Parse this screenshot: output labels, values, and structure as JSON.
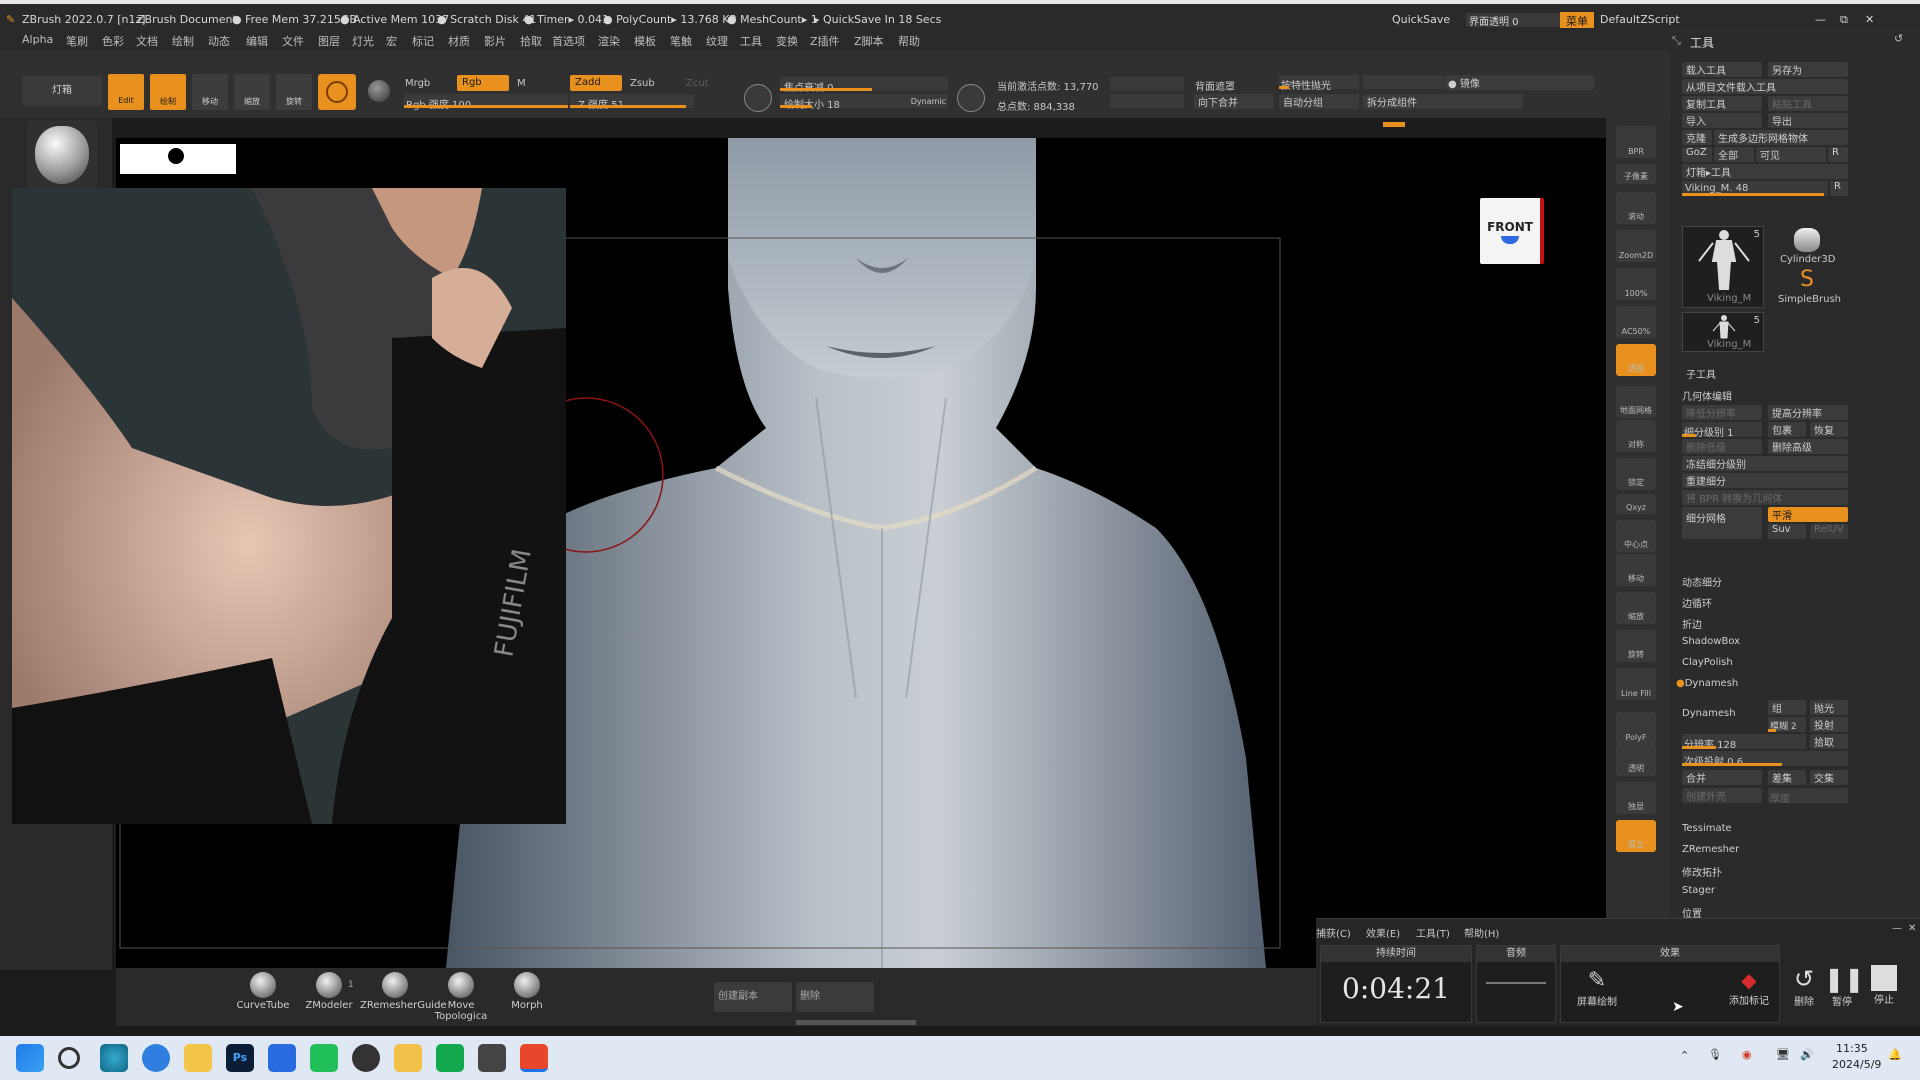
{
  "titlebar": {
    "app": "ZBrush 2022.0.7 [n1z]",
    "doc": "ZBrush Document",
    "free_mem": "● Free Mem 37.215GB",
    "active_mem": "● Active Mem 1037",
    "scratch": "● Scratch Disk 41",
    "timer": "● Timer▸ 0.041",
    "poly": "● PolyCount▸ 13.768 KP",
    "mesh": "● MeshCount▸ 1",
    "quicksave": "▸ QuickSave In 18 Secs",
    "quicksave_btn": "QuickSave",
    "interface_trans": "界面透明 0",
    "menu_btn": "菜单",
    "script": "DefaultZScript"
  },
  "menus": [
    "Alpha",
    "笔刷",
    "色彩",
    "文档",
    "绘制",
    "动态",
    "编辑",
    "文件",
    "图层",
    "灯光",
    "宏",
    "标记",
    "材质",
    "影片",
    "拾取",
    "首选项",
    "渲染",
    "模板",
    "笔触",
    "纹理",
    "工具",
    "变换",
    "Z插件",
    "Z脚本",
    "帮助"
  ],
  "shelf": {
    "lightbox": "灯箱",
    "edit": "Edit",
    "draw": "绘制",
    "move": "移动",
    "scale": "缩放",
    "rotate": "旋转",
    "mrgb": "Mrgb",
    "rgb": "Rgb",
    "m": "M",
    "rgb_intensity": "Rgb 强度 100",
    "zadd": "Zadd",
    "zsub": "Zsub",
    "zcut": "Zcut",
    "focal_shift": "焦点衰减 0",
    "draw_size": "绘制大小 18",
    "dynamic": "Dynamic",
    "active_points": "当前激活点数: 13,770",
    "total_points": "总点数: 884,338",
    "z_intensity": "Z 强度 51",
    "backface": "背面遮罩",
    "merge_down": "向下合并",
    "auto_group": "自动分组",
    "polish": "按特性抛光",
    "split_group": "拆分成组件",
    "mirror": "镜像"
  },
  "reference_image": {
    "brand": "FUJIFILM"
  },
  "nav": [
    {
      "label": "BPR"
    },
    {
      "label": "子像素"
    },
    {
      "label": "滚动"
    },
    {
      "label": "Zoom2D"
    },
    {
      "label": "100%"
    },
    {
      "label": "AC50%"
    },
    {
      "label": "透视"
    },
    {
      "label": "地面网格"
    },
    {
      "label": "对称"
    },
    {
      "label": "锁定"
    },
    {
      "label": "Qxyz"
    },
    {
      "label": "中心点"
    },
    {
      "label": "移动"
    },
    {
      "label": "缩放"
    },
    {
      "label": "旋转"
    },
    {
      "label": "Line Fill"
    },
    {
      "label": "PolyF"
    },
    {
      "label": "透明"
    },
    {
      "label": "独显"
    },
    {
      "label": "孤立"
    }
  ],
  "gizmo": {
    "label": "FRONT"
  },
  "tool_panel": {
    "title": "工具",
    "load": "载入工具",
    "save_as": "另存为",
    "load_from_project": "从项目文件载入工具",
    "copy": "复制工具",
    "paste": "粘贴工具",
    "import": "导入",
    "export": "导出",
    "clone": "克隆",
    "make_polymesh": "生成多边形网格物体",
    "goz": "GoZ",
    "all": "全部",
    "visible": "可见",
    "r": "R",
    "lightbox_tools": "灯箱▸工具",
    "viking_slider": "Viking_M. 48",
    "thumb1": "Viking_M",
    "thumb1_n": "5",
    "thumb2": "Cylinder3D",
    "thumb3": "SimpleBrush",
    "thumb4": "Viking_M",
    "thumb4_n": "5",
    "subtool": "子工具",
    "geometry": "几何体编辑",
    "lower_res": "降低分辨率",
    "higher_res": "提高分辨率",
    "sdiv": "细分级别 1",
    "cage": "包裹",
    "restore": "恢复",
    "del_lower": "删除低级",
    "del_higher": "删除高级",
    "freeze": "冻结细分级别",
    "reconstruct": "重建细分",
    "convert_bpr": "将 BPR 转换为几何体",
    "divide": "细分网格",
    "smooth": "平滑",
    "suv": "Suv",
    "reluv": "RelUV",
    "dyn_subdiv": "动态细分",
    "edge_loop": "边循环",
    "crease": "折边",
    "shadowbox": "ShadowBox",
    "claypolish": "ClayPolish",
    "dynamesh_h": "Dynamesh",
    "dynamesh": "Dynamesh",
    "group": "组",
    "polish": "抛光",
    "blur": "模糊 2",
    "project": "投射",
    "resolution": "分辨率 128",
    "sub_proj": "次级投射 0.6",
    "add": "合并",
    "sub": "差集",
    "intersect": "交集",
    "create_shell": "创建外壳",
    "thickness": "厚度",
    "tessimate": "Tessimate",
    "zremesher": "ZRemesher",
    "modify_topo": "修改拓扑",
    "stager": "Stager",
    "position": "位置"
  },
  "bottom_brushes": [
    {
      "label": "CurveTube"
    },
    {
      "label": "ZModeler"
    },
    {
      "label": "ZRemesherGuide"
    },
    {
      "label": "Move Topologica"
    },
    {
      "label": "Morph"
    }
  ],
  "bottom_actions": {
    "create_copy": "创建副本",
    "delete": "删除"
  },
  "recorder": {
    "menu_capture": "捕获(C)",
    "menu_effects": "效果(E)",
    "menu_tools": "工具(T)",
    "menu_help": "帮助(H)",
    "duration_h": "持续时间",
    "audio_h": "音频",
    "effects_h": "效果",
    "time": "0:04:21",
    "screen_draw": "屏幕绘制",
    "add_marker": "添加标记",
    "delete": "删除",
    "pause": "暂停",
    "stop": "停止"
  },
  "taskbar": {
    "time": "11:35",
    "date": "2024/5/9"
  },
  "colors": {
    "accent": "#e8911e",
    "taskbar": "#dfe8f3"
  }
}
